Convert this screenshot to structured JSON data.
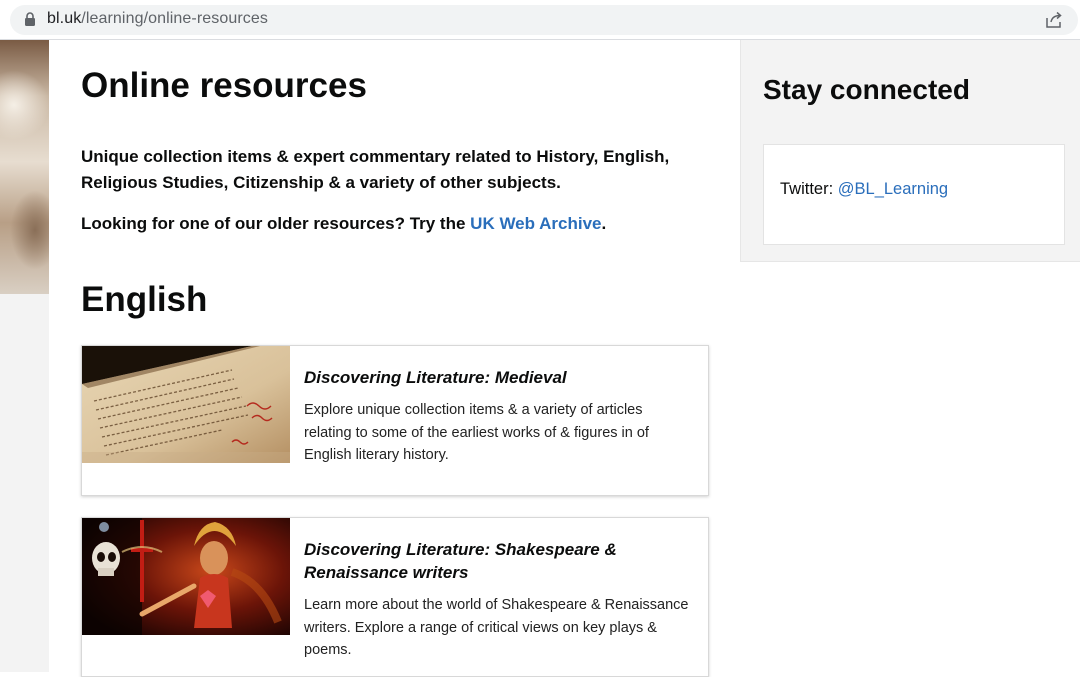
{
  "browser": {
    "url_domain": "bl.uk",
    "url_path": "/learning/online-resources",
    "icons": [
      "lock-icon",
      "share-icon"
    ]
  },
  "main": {
    "title": "Online resources",
    "intro": "Unique collection items & expert commentary related to History, English, Religious Studies, Citizenship & a variety of other subjects.",
    "older_prefix": "Looking for one of our older resources? Try the ",
    "older_link": "UK Web Archive",
    "older_suffix": ".",
    "section_title": "English",
    "cards": [
      {
        "title": "Discovering Literature: Medieval",
        "description": "Explore unique collection items & a variety of articles relating to some of the earliest works of & figures in of English literary history."
      },
      {
        "title": "Discovering Literature: Shakespeare & Renaissance writers",
        "description": "Learn more about the world of Shakespeare & Renaissance writers. Explore a range of critical views on key plays & poems."
      }
    ]
  },
  "sidebar": {
    "title": "Stay connected",
    "twitter_label": "Twitter: ",
    "twitter_handle": "@BL_Learning"
  },
  "colors": {
    "link": "#2a6ebb",
    "sidebar_bg": "#f3f3f3",
    "text": "#0b0c0c"
  }
}
